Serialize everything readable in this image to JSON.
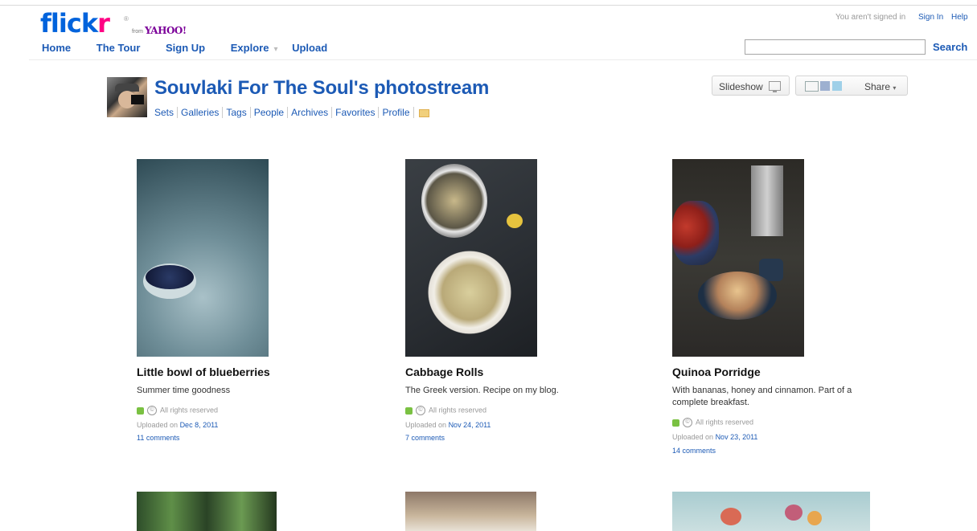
{
  "header": {
    "logo": {
      "flickr_blue": "flick",
      "flickr_pink": "r",
      "reg": "®",
      "from": "from",
      "yahoo": "YAHOO!"
    },
    "nav": [
      "Home",
      "The Tour",
      "Sign Up",
      "Explore",
      "Upload"
    ],
    "explore_caret": "▾",
    "signed_status": "You aren't signed in",
    "sign_in": "Sign In",
    "help": "Help",
    "search_placeholder": "",
    "search_button": "Search"
  },
  "profile": {
    "title": "Souvlaki For The Soul's photostream",
    "subnav": [
      "Sets",
      "Galleries",
      "Tags",
      "People",
      "Archives",
      "Favorites",
      "Profile"
    ],
    "slideshow": "Slideshow",
    "share": "Share"
  },
  "photos": [
    {
      "title": "Little bowl of blueberries",
      "description": "Summer time goodness",
      "rights": "All rights reserved",
      "uploaded_prefix": "Uploaded on",
      "date": "Dec 8, 2011",
      "comments": "11 comments"
    },
    {
      "title": "Cabbage Rolls",
      "description": "The Greek version. Recipe on my blog.",
      "rights": "All rights reserved",
      "uploaded_prefix": "Uploaded on",
      "date": "Nov 24, 2011",
      "comments": "7 comments"
    },
    {
      "title": "Quinoa Porridge",
      "description": "With bananas, honey and cinnamon. Part of a complete breakfast.",
      "rights": "All rights reserved",
      "uploaded_prefix": "Uploaded on",
      "date": "Nov 23, 2011",
      "comments": "14 comments"
    }
  ],
  "icons": {
    "copyright": "©",
    "colors": {
      "link": "#1c5ab5",
      "flickr_blue": "#0063dc",
      "flickr_pink": "#ff0084",
      "license_green": "#7ac142"
    }
  }
}
